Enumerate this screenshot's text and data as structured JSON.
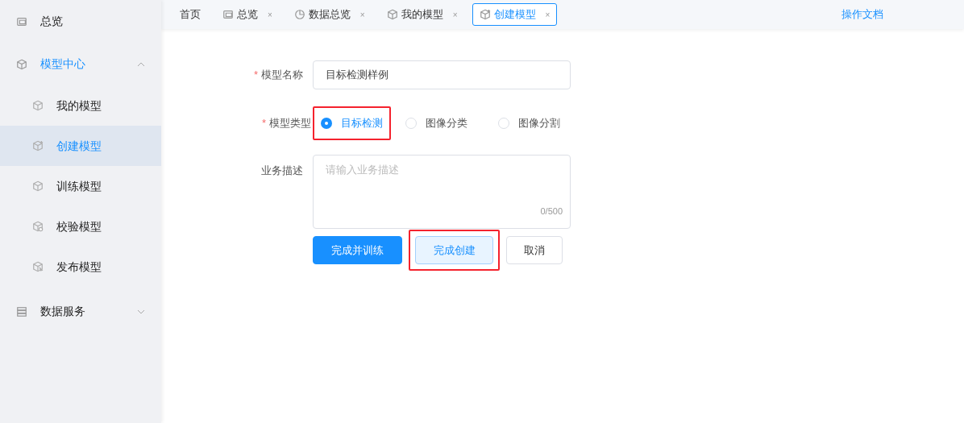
{
  "sidebar": {
    "items": [
      {
        "label": "总览"
      },
      {
        "label": "模型中心",
        "expanded": true,
        "children": [
          {
            "label": "我的模型",
            "selected": false
          },
          {
            "label": "创建模型",
            "selected": true
          },
          {
            "label": "训练模型",
            "selected": false
          },
          {
            "label": "校验模型",
            "selected": false
          },
          {
            "label": "发布模型",
            "selected": false
          }
        ]
      },
      {
        "label": "数据服务",
        "expanded": false
      }
    ]
  },
  "tabs": [
    {
      "label": "首页",
      "selected": false
    },
    {
      "label": "总览",
      "close": "×",
      "selected": false
    },
    {
      "label": "数据总览",
      "close": "×",
      "selected": false
    },
    {
      "label": "我的模型",
      "close": "×",
      "selected": false
    },
    {
      "label": "创建模型",
      "close": "×",
      "selected": true
    }
  ],
  "docs_link": "操作文档",
  "form": {
    "name": {
      "label": "模型名称",
      "required": true,
      "value": "目标检测样例"
    },
    "type": {
      "label": "模型类型",
      "required": true,
      "options": [
        {
          "label": "目标检测",
          "selected": true,
          "highlighted": true
        },
        {
          "label": "图像分类",
          "selected": false,
          "highlighted": false
        },
        {
          "label": "图像分割",
          "selected": false,
          "highlighted": false
        }
      ]
    },
    "description": {
      "label": "业务描述",
      "required": false,
      "placeholder": "请输入业务描述",
      "counter": "0/500"
    },
    "required_mark": "*",
    "buttons": [
      {
        "label": "完成并训练",
        "kind": "primary",
        "highlighted": false
      },
      {
        "label": "完成创建",
        "kind": "plain",
        "highlighted": true
      },
      {
        "label": "取消",
        "kind": "default",
        "highlighted": false
      }
    ]
  }
}
